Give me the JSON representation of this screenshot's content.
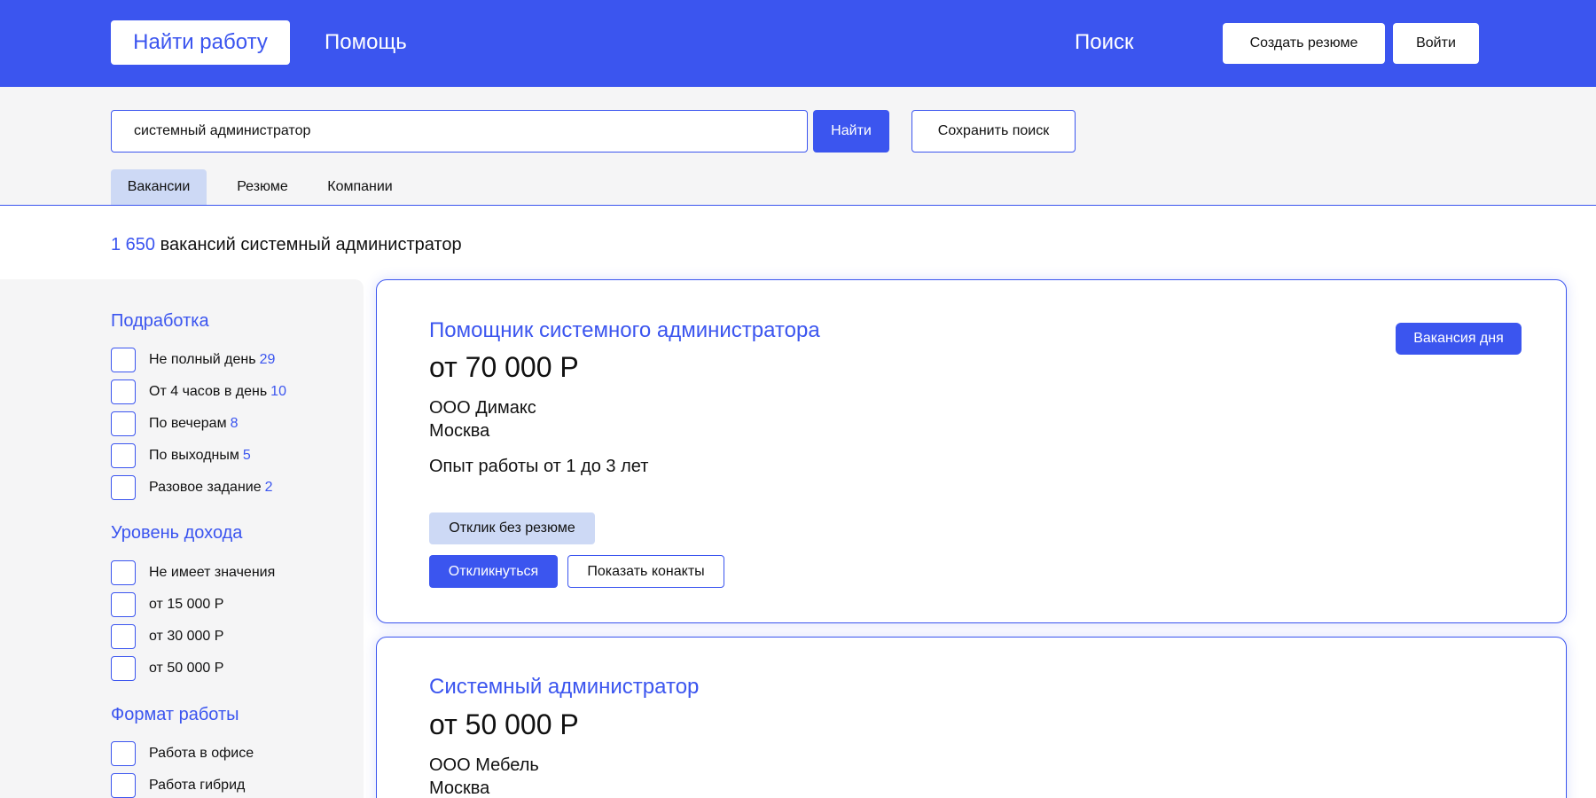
{
  "header": {
    "find_work": "Найти работу",
    "help": "Помощь",
    "search": "Поиск",
    "create_resume": "Создать резюме",
    "login": "Войти"
  },
  "search": {
    "value": "системный администратор",
    "find_button": "Найти",
    "save_button": "Сохранить поиск",
    "tabs": [
      "Вакансии",
      "Резюме",
      "Компании"
    ]
  },
  "results": {
    "count": "1 650",
    "text": "вакансий системный администратор"
  },
  "filters": {
    "parttime": {
      "title": "Подработка",
      "items": [
        {
          "label": "Не полный день",
          "count": "29"
        },
        {
          "label": "От 4 часов в день",
          "count": "10"
        },
        {
          "label": "По вечерам",
          "count": "8"
        },
        {
          "label": "По выходным",
          "count": "5"
        },
        {
          "label": "Разовое задание",
          "count": "2"
        }
      ]
    },
    "income": {
      "title": "Уровень дохода",
      "items": [
        {
          "label": "Не имеет значения"
        },
        {
          "label": "от 15 000 Р"
        },
        {
          "label": "от 30 000 Р"
        },
        {
          "label": "от 50 000 Р"
        }
      ]
    },
    "format": {
      "title": "Формат работы",
      "items": [
        {
          "label": "Работа в офисе"
        },
        {
          "label": "Работа гибрид"
        }
      ]
    }
  },
  "vacancies": [
    {
      "title": "Помощник системного администратора",
      "salary": "от 70 000 Р",
      "company": "ООО Димакс",
      "city": "Москва",
      "experience": "Опыт работы от 1 до 3 лет",
      "badge": "Вакансия дня",
      "tag": "Отклик без резюме",
      "respond": "Откликнуться",
      "contacts": "Показать конакты"
    },
    {
      "title": "Системный администратор",
      "salary": "от 50 000 Р",
      "company": "ООО Мебель",
      "city": "Москва"
    }
  ],
  "colors": {
    "accent": "#3b55ef",
    "tab_active": "#cdd9f5",
    "panel": "#f5f5f6"
  }
}
